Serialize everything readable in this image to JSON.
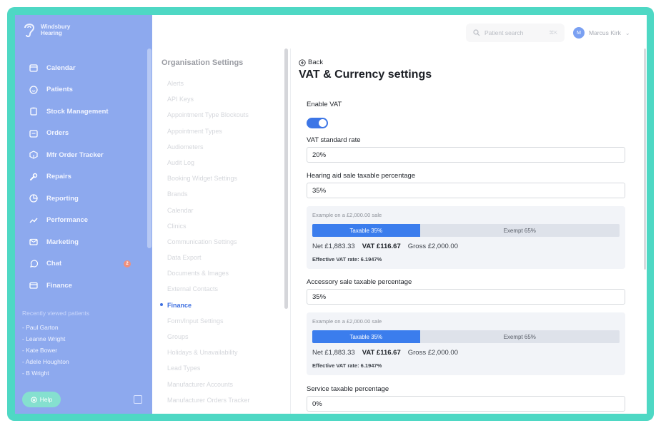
{
  "brand": {
    "name_line1": "Windsbury",
    "name_line2": "Hearing"
  },
  "sidebar": {
    "items": [
      {
        "label": "Calendar",
        "icon": "calendar-icon"
      },
      {
        "label": "Patients",
        "icon": "smiley-icon"
      },
      {
        "label": "Stock Management",
        "icon": "clipboard-icon"
      },
      {
        "label": "Orders",
        "icon": "orders-icon"
      },
      {
        "label": "Mfr Order Tracker",
        "icon": "package-icon"
      },
      {
        "label": "Repairs",
        "icon": "wrench-icon"
      },
      {
        "label": "Reporting",
        "icon": "pie-chart-icon"
      },
      {
        "label": "Performance",
        "icon": "trend-icon"
      },
      {
        "label": "Marketing",
        "icon": "mail-icon"
      },
      {
        "label": "Chat",
        "icon": "chat-icon",
        "badge": "2"
      },
      {
        "label": "Finance",
        "icon": "card-icon"
      }
    ],
    "recent_title": "Recently viewed patients",
    "recent": [
      "- Paul Garton",
      "- Leanne Wright",
      "- Kate Bower",
      "- Adele Houghton",
      "- B Wright"
    ],
    "help_label": "Help"
  },
  "topbar": {
    "search_label": "Patient search",
    "search_shortcut": "⌘K",
    "user_name": "Marcus Kirk",
    "user_initial": "M"
  },
  "settings": {
    "title": "Organisation Settings",
    "active": "Finance",
    "items": [
      "Alerts",
      "API Keys",
      "Appointment Type Blockouts",
      "Appointment Types",
      "Audiometers",
      "Audit Log",
      "Booking Widget Settings",
      "Brands",
      "Calendar",
      "Clinics",
      "Communication Settings",
      "Data Export",
      "Documents & Images",
      "External Contacts",
      "Finance",
      "Form/Input Settings",
      "Groups",
      "Holidays & Unavailability",
      "Lead Types",
      "Manufacturer Accounts",
      "Manufacturer Orders Tracker"
    ]
  },
  "main": {
    "back_label": "Back",
    "title": "VAT & Currency settings",
    "enable_vat_label": "Enable VAT",
    "enable_vat_on": true,
    "vat_rate_label": "VAT standard rate",
    "vat_rate_value": "20%",
    "hearing_label": "Hearing aid sale taxable percentage",
    "hearing_value": "35%",
    "hearing_example": {
      "caption": "Example on a £2,000.00 sale",
      "taxable_fraction": 0.35,
      "taxable_label": "Taxable 35%",
      "exempt_label": "Exempt 65%",
      "net": "Net £1,883.33",
      "vat": "VAT £116.67",
      "gross": "Gross £2,000.00",
      "effective": "Effective VAT rate: 6.1947%"
    },
    "accessory_label": "Accessory sale taxable percentage",
    "accessory_value": "35%",
    "accessory_example": {
      "caption": "Example on a £2,000.00 sale",
      "taxable_fraction": 0.35,
      "taxable_label": "Taxable 35%",
      "exempt_label": "Exempt 65%",
      "net": "Net £1,883.33",
      "vat": "VAT £116.67",
      "gross": "Gross £2,000.00",
      "effective": "Effective VAT rate: 6.1947%"
    },
    "service_label": "Service taxable percentage",
    "service_value": "0%"
  }
}
